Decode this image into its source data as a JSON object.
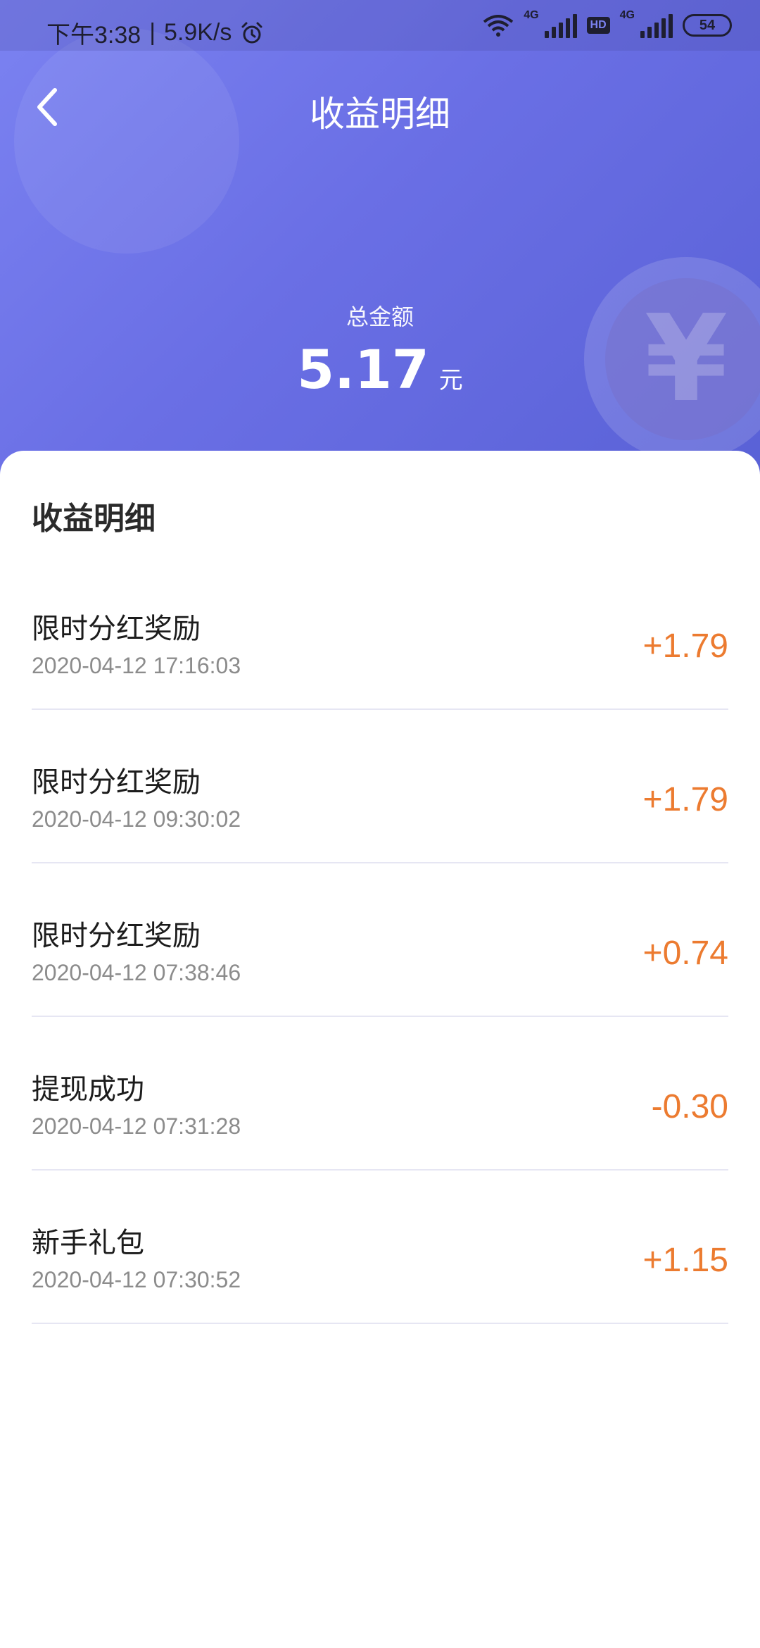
{
  "status": {
    "time": "下午3:38",
    "speed": "5.9K/s",
    "net_tag_1": "4G",
    "net_tag_2": "4G",
    "hd": "HD",
    "battery": "54"
  },
  "header": {
    "title": "收益明细",
    "total_label": "总金额",
    "total_amount": "5.17",
    "total_unit": "元",
    "coin_symbol": "¥"
  },
  "section": {
    "title": "收益明细"
  },
  "records": [
    {
      "name": "限时分红奖励",
      "time": "2020-04-12 17:16:03",
      "amount": "+1.79"
    },
    {
      "name": "限时分红奖励",
      "time": "2020-04-12 09:30:02",
      "amount": "+1.79"
    },
    {
      "name": "限时分红奖励",
      "time": "2020-04-12 07:38:46",
      "amount": "+0.74"
    },
    {
      "name": "提现成功",
      "time": "2020-04-12 07:31:28",
      "amount": "-0.30"
    },
    {
      "name": "新手礼包",
      "time": "2020-04-12 07:30:52",
      "amount": "+1.15"
    }
  ],
  "colors": {
    "header_start": "#7b82f1",
    "header_end": "#5961d6",
    "amount": "#ec7b30"
  },
  "icons": [
    "back-arrow-icon",
    "alarm-icon",
    "wifi-icon",
    "signal-icon",
    "battery-icon",
    "yen-coin-icon"
  ]
}
